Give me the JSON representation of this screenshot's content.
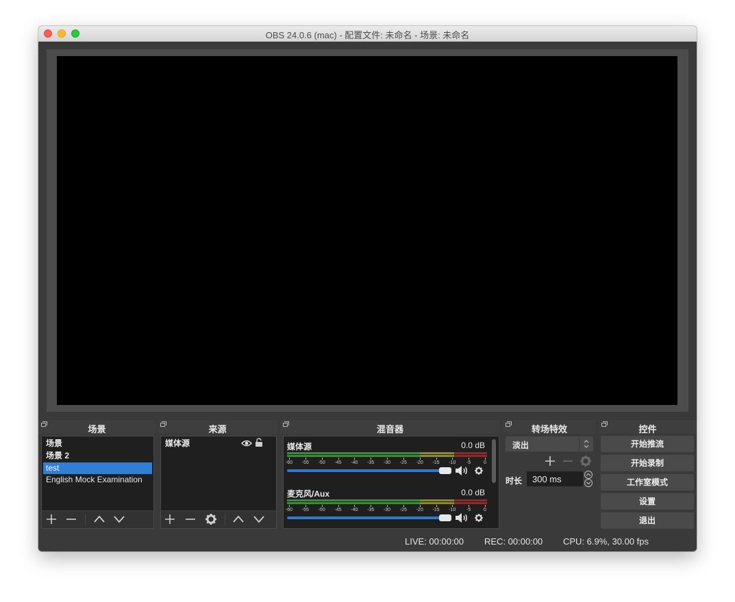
{
  "window": {
    "title": "OBS 24.0.6 (mac) - 配置文件: 未命名 - 场景: 未命名"
  },
  "scenes": {
    "header": "场景",
    "items": [
      {
        "label": "场景",
        "bold": true,
        "selected": false
      },
      {
        "label": "场景 2",
        "bold": true,
        "selected": false
      },
      {
        "label": "test",
        "bold": false,
        "selected": true
      },
      {
        "label": "English Mock Examination",
        "bold": false,
        "selected": false
      }
    ],
    "toolbar_icons": [
      "plus-icon",
      "minus-icon",
      "chevron-up-icon",
      "chevron-down-icon"
    ]
  },
  "sources": {
    "header": "来源",
    "items": [
      {
        "label": "媒体源",
        "visible": true,
        "locked": false
      }
    ],
    "toolbar_icons": [
      "plus-icon",
      "minus-icon",
      "gear-icon",
      "chevron-up-icon",
      "chevron-down-icon"
    ]
  },
  "mixer": {
    "header": "混音器",
    "ticks": [
      "-60",
      "-55",
      "-50",
      "-45",
      "-40",
      "-35",
      "-30",
      "-25",
      "-20",
      "-15",
      "-10",
      "-5",
      "0"
    ],
    "channels": [
      {
        "name": "媒体源",
        "db": "0.0 dB",
        "volume": 1.0
      },
      {
        "name": "麦克风/Aux",
        "db": "0.0 dB",
        "volume": 1.0
      }
    ]
  },
  "transitions": {
    "header": "转场特效",
    "selected": "淡出",
    "duration_label": "时长",
    "duration_value": "300 ms"
  },
  "controls": {
    "header": "控件",
    "buttons": [
      "开始推流",
      "开始录制",
      "工作室模式",
      "设置",
      "退出"
    ]
  },
  "status": {
    "live": "LIVE: 00:00:00",
    "rec": "REC: 00:00:00",
    "cpu": "CPU: 6.9%, 30.00 fps"
  },
  "colors": {
    "selection": "#2f7fd6",
    "meter_green": "#3c8a3c",
    "meter_yellow": "#8c8a30",
    "meter_red": "#8b2b2b"
  }
}
